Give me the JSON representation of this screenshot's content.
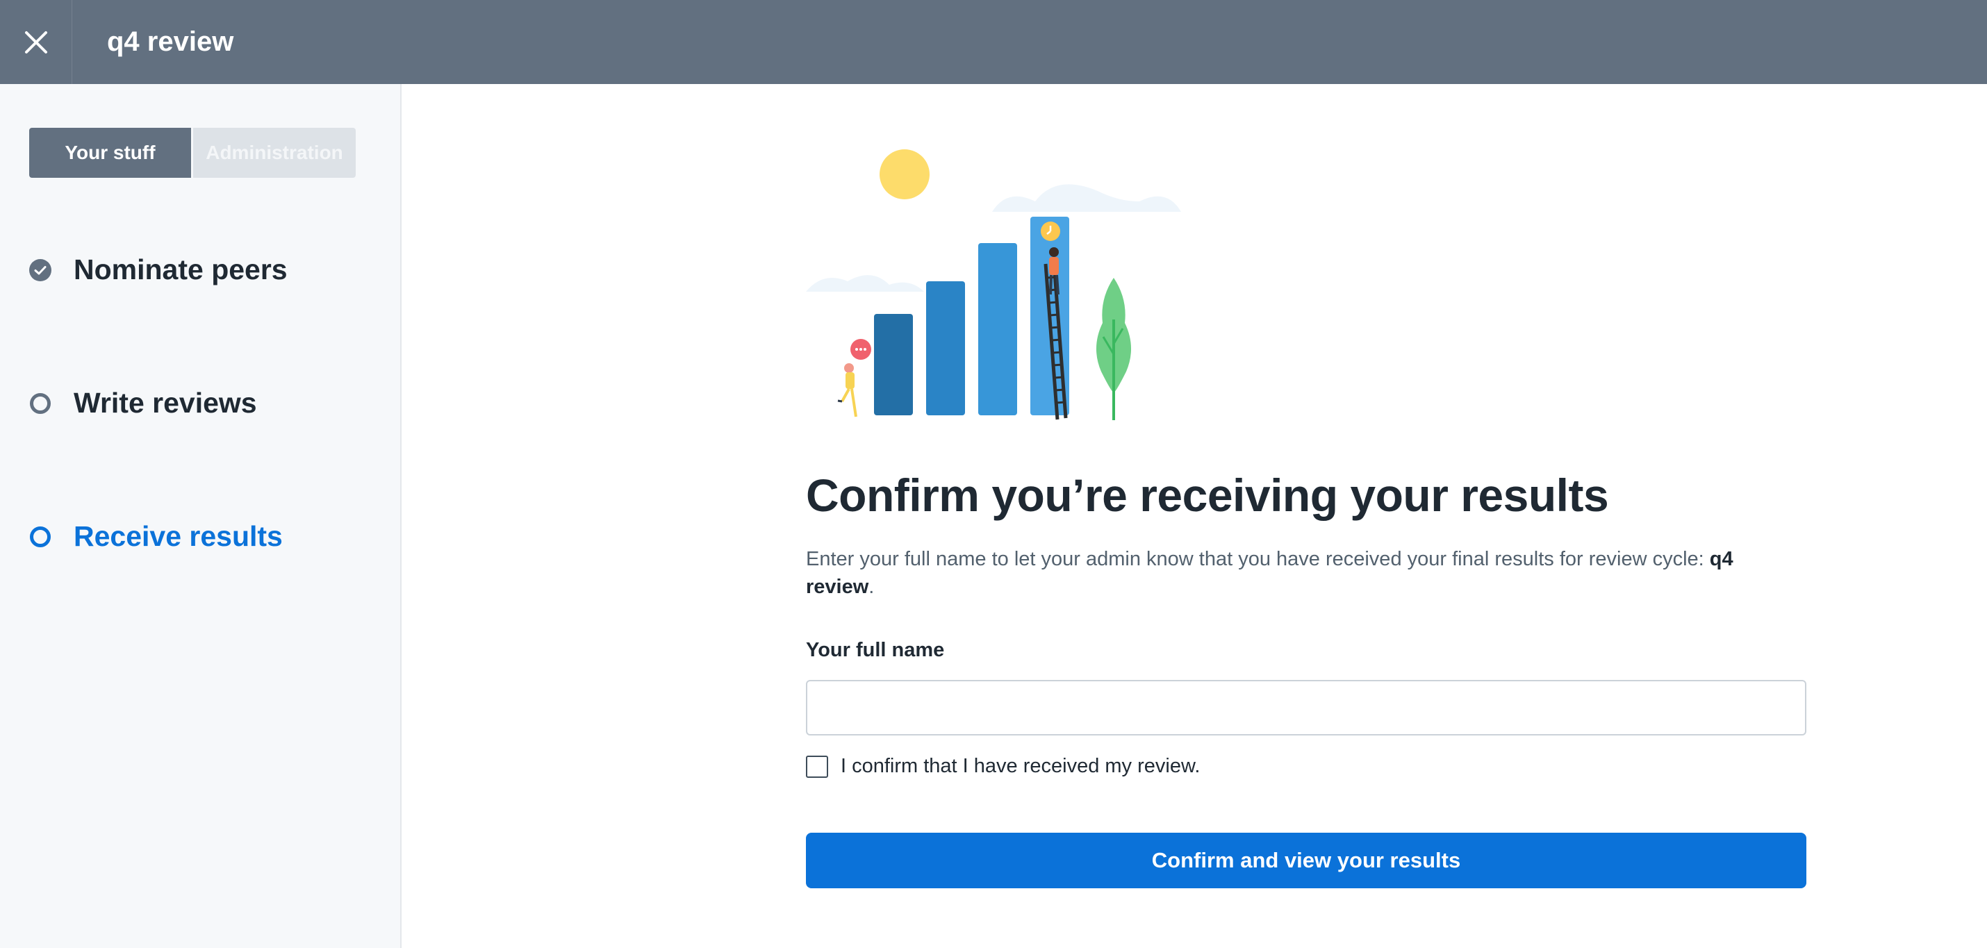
{
  "header": {
    "title": "q4 review",
    "close_icon": "close-icon"
  },
  "sidebar": {
    "segments": [
      {
        "label": "Your stuff",
        "active": true
      },
      {
        "label": "Administration",
        "active": false
      }
    ],
    "steps": [
      {
        "label": "Nominate peers",
        "status": "complete",
        "icon": "check-circle-icon"
      },
      {
        "label": "Write reviews",
        "status": "pending",
        "icon": "ring-icon"
      },
      {
        "label": "Receive results",
        "status": "current",
        "icon": "ring-icon"
      }
    ]
  },
  "main": {
    "illustration_icon": "bar-chart-ladder-illustration",
    "heading": "Confirm you’re receiving your results",
    "description_prefix": "Enter your full name to let your admin know that you have received your final results for review cycle: ",
    "description_cycle": "q4 review",
    "description_suffix": ".",
    "full_name_label": "Your full name",
    "full_name_value": "",
    "confirm_checkbox_label": "I confirm that I have received my review.",
    "confirm_checkbox_checked": false,
    "submit_label": "Confirm and view your results"
  },
  "colors": {
    "topbar": "#627080",
    "accent": "#0b72d9",
    "sidebar_bg": "#f6f8fa",
    "text_dark": "#1f2933",
    "text_muted": "#52606d"
  }
}
